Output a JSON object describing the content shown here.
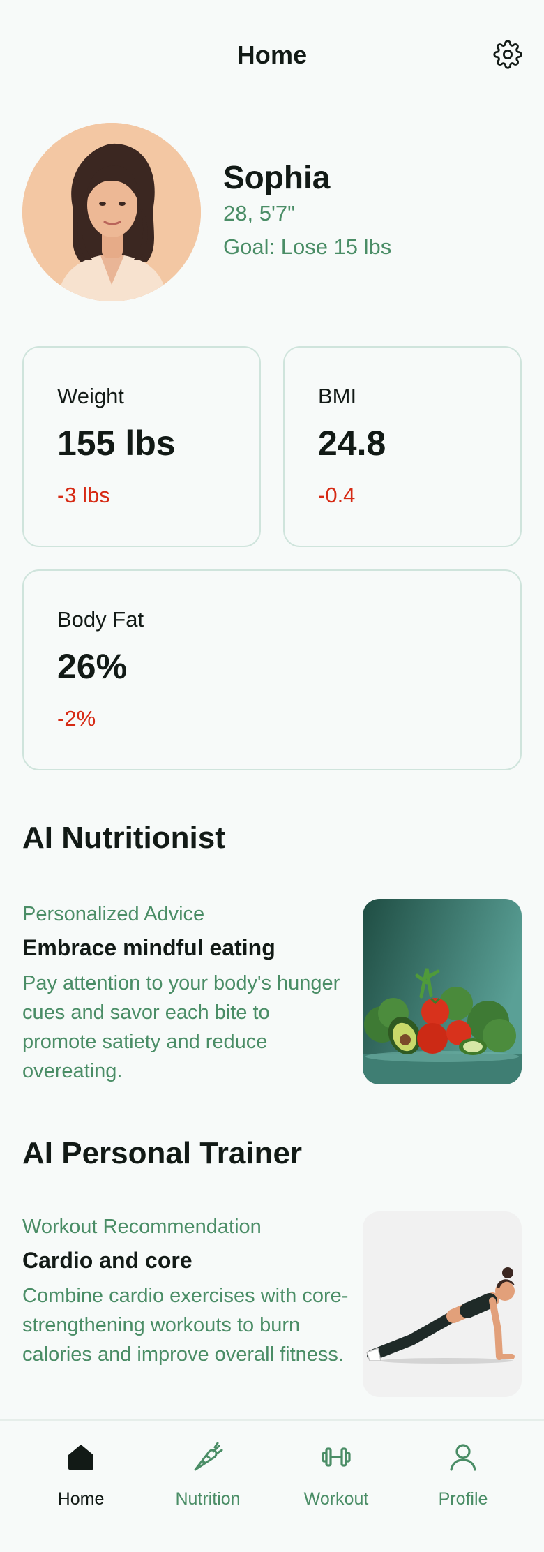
{
  "header": {
    "title": "Home",
    "settings_icon": "gear-icon"
  },
  "profile": {
    "name": "Sophia",
    "details": "28, 5'7\"",
    "goal": "Goal: Lose 15 lbs",
    "avatar_icon": "user-portrait"
  },
  "stats": [
    {
      "label": "Weight",
      "value": "155 lbs",
      "delta": "-3 lbs"
    },
    {
      "label": "BMI",
      "value": "24.8",
      "delta": "-0.4"
    },
    {
      "label": "Body Fat",
      "value": "26%",
      "delta": "-2%"
    }
  ],
  "nutritionist": {
    "section_title": "AI Nutritionist",
    "kicker": "Personalized Advice",
    "heading": "Embrace mindful eating",
    "description": "Pay attention to your body's hunger cues and savor each bite to promote satiety and reduce overeating.",
    "image_icon": "vegetables-image"
  },
  "trainer": {
    "section_title": "AI Personal Trainer",
    "kicker": "Workout Recommendation",
    "heading": "Cardio and core",
    "description": "Combine cardio exercises with core-strengthening workouts to burn calories and improve overall fitness.",
    "image_icon": "plank-exercise-image"
  },
  "tabs": [
    {
      "label": "Home",
      "icon": "home-icon",
      "active": true
    },
    {
      "label": "Nutrition",
      "icon": "carrot-icon",
      "active": false
    },
    {
      "label": "Workout",
      "icon": "dumbbell-icon",
      "active": false
    },
    {
      "label": "Profile",
      "icon": "user-icon",
      "active": false
    }
  ],
  "colors": {
    "accent_green": "#4a8d66",
    "negative_red": "#d62a14",
    "card_border": "#cfe4dc",
    "background": "#f7faf9"
  }
}
